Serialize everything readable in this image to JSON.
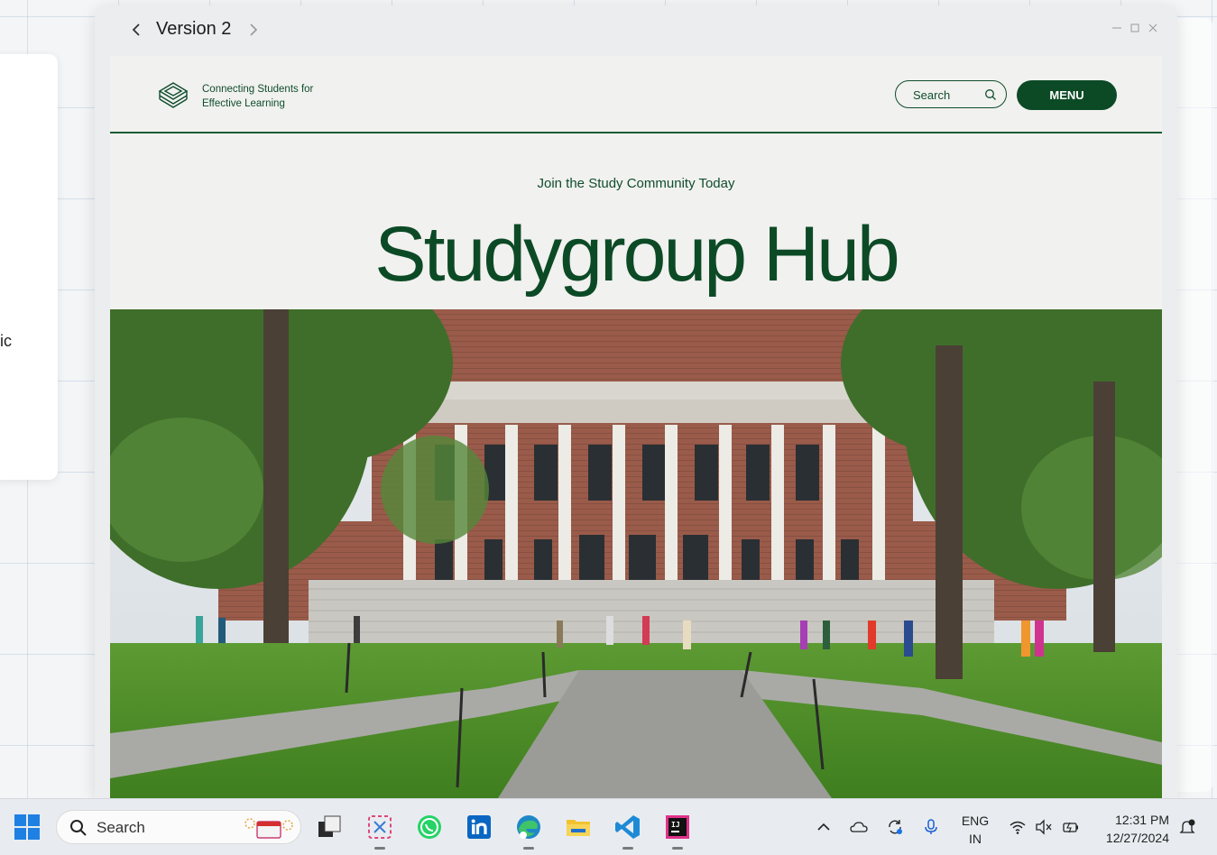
{
  "window": {
    "title": "Version 2"
  },
  "site": {
    "tagline": "Connecting Students for Effective Learning",
    "search_placeholder": "Search",
    "menu_label": "MENU",
    "eyebrow": "Join the Study Community Today",
    "hero_title": "Studygroup Hub",
    "hero_image_icon": "campus-library-photo"
  },
  "desktop": {
    "side_panel_text": "ic"
  },
  "taskbar": {
    "search_label": "Search",
    "apps": [
      "start-icon",
      "task-view-icon",
      "snipping-tool-icon",
      "whatsapp-icon",
      "linkedin-icon",
      "edge-icon",
      "file-explorer-icon",
      "vscode-icon",
      "intellij-icon"
    ],
    "tray": {
      "lang_line1": "ENG",
      "lang_line2": "IN",
      "time": "12:31 PM",
      "date": "12/27/2024"
    }
  },
  "colors": {
    "brand_green": "#0c4a26",
    "page_bg": "#f1f1ef"
  }
}
